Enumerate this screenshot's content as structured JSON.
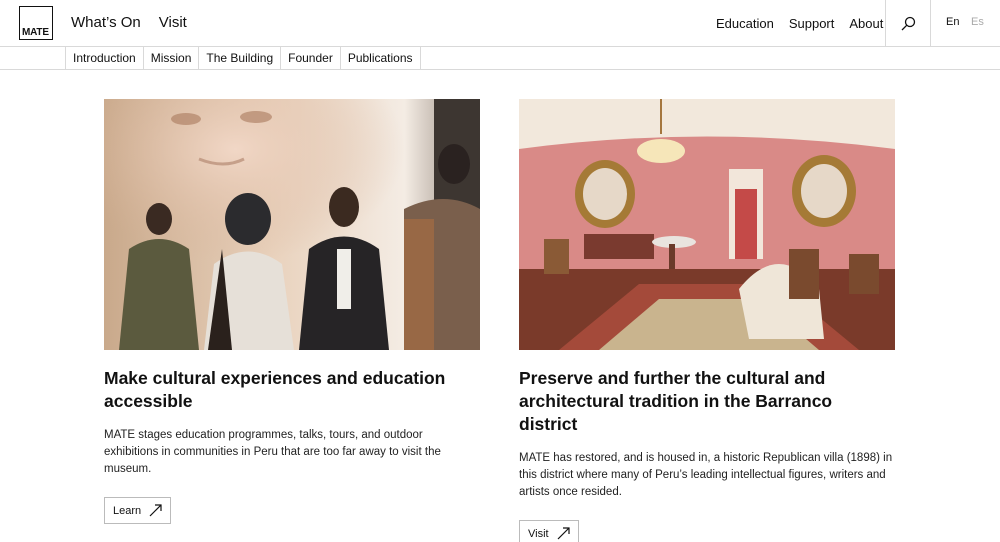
{
  "header": {
    "logo_text": "MATE",
    "primary_nav": [
      "What’s On",
      "Visit"
    ],
    "secondary_nav": [
      "Education",
      "Support",
      "About"
    ],
    "lang_en": "En",
    "lang_es": "Es"
  },
  "subnav": [
    "Introduction",
    "Mission",
    "The Building",
    "Founder",
    "Publications"
  ],
  "cards": [
    {
      "title": "Make cultural experiences and education accessible",
      "body": "MATE stages education programmes, talks, tours, and outdoor exhibitions in communities in Peru that are too far away to visit the museum.",
      "button": "Learn"
    },
    {
      "title": "Preserve and further the cultural and architectural tradition in the Barranco district",
      "body": "MATE has restored, and is housed in, a historic Republican villa (1898) in this district where many of Peru’s leading intellectual figures, writers and artists once resided.",
      "button": "Visit"
    }
  ]
}
